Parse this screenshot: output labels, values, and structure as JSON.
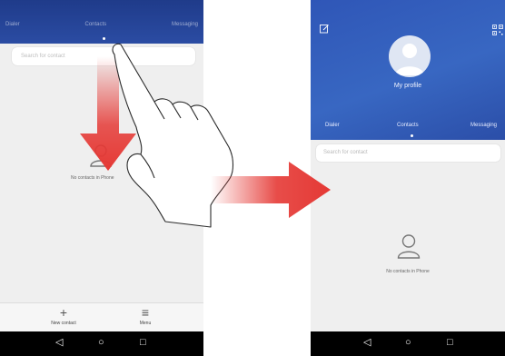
{
  "left_screen": {
    "tabs": [
      "Dialer",
      "Contacts",
      "Messaging"
    ],
    "search_placeholder": "Search for contact",
    "empty_text": "No contacts in Phone",
    "bottom_actions": [
      {
        "label": "New contact",
        "icon": "plus-icon",
        "glyph": "+"
      },
      {
        "label": "Menu",
        "icon": "menu-icon",
        "glyph": "≡"
      }
    ]
  },
  "right_screen": {
    "profile_label": "My profile",
    "tabs": [
      "Dialer",
      "Contacts",
      "Messaging"
    ],
    "search_placeholder": "Search for contact",
    "empty_text": "No contacts in Phone"
  },
  "nav_bar": {
    "back_glyph": "◁",
    "home_glyph": "○",
    "recents_glyph": "□"
  },
  "colors": {
    "header_blue": "#2f56b7",
    "arrow_red": "#e53935"
  }
}
